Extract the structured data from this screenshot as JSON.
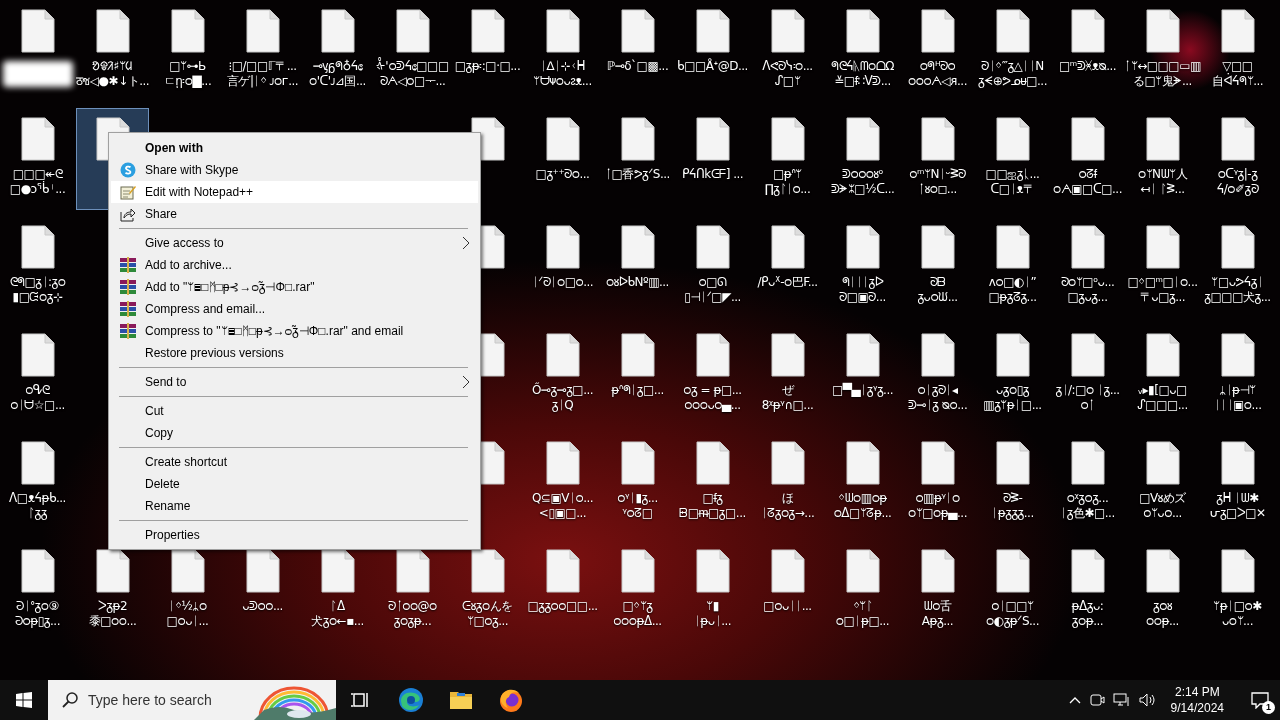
{
  "desktop": {
    "rows": [
      {
        "icons": [
          {
            "kind": "redacted",
            "selected": false
          },
          {
            "kind": "file",
            "selected": false,
            "label": [
              "ᱚᱫᱤ♯ᛘᱢ",
              "ठช◁●✱↓ト..."
            ]
          },
          {
            "kind": "file",
            "selected": false,
            "label": [
              "□ᛘ⊶Ь",
              "ㄷῃ፡ᴑ▇..."
            ]
          },
          {
            "kind": "file",
            "selected": false,
            "label": [
              "⁝□/□□ℾ〒...",
              "言ゲ|ᛁᛜ ᴊᴑᴦ..."
            ]
          },
          {
            "kind": "file",
            "selected": false,
            "label": [
              "⊸ᶌᵷᖗ♁ᔦ᥋",
              "ᴑ'ᑕ'ᴊ⊿国..."
            ]
          },
          {
            "kind": "file",
            "selected": false,
            "label": [
              "ᢤ'ᴑᕲᔦ᥋□□□",
              "ᘐᗅ◁ᴑ□ᅮ..."
            ]
          },
          {
            "kind": "file",
            "selected": false,
            "label": [
              "□ᵹᵽ፡:□·□..."
            ]
          },
          {
            "kind": "file",
            "selected": false,
            "label": [
              "ᛁ∆ᛁ⊹ᚲᕼ",
              "ᛘᗨᴪᴑᴗᴤᴥ..."
            ]
          },
          {
            "kind": "file",
            "selected": false,
            "label": [
              "ℙ⊸δ`□▩..."
            ]
          },
          {
            "kind": "file",
            "selected": false,
            "label": [
              "ᑲ□□Åᕀ@D..."
            ]
          },
          {
            "kind": "file",
            "selected": false,
            "label": [
              "ᐱᕙᘐᓭ፡ᴑ...",
              "ᔑ□ᛘ"
            ]
          },
          {
            "kind": "file",
            "selected": false,
            "label": [
              "ᖗᘓᔦᚣᗰᴑᗝΩ",
              "≚□ᵮ∷ᐯᕲ..."
            ]
          },
          {
            "kind": "file",
            "selected": false,
            "label": [
              "ᴑᖗᵸᘐᴑ",
              "ᴑᴑᴑᗅ◁ᴙ..."
            ]
          },
          {
            "kind": "file",
            "selected": false,
            "label": [
              "ᘐᛁᛜ‴ᵹ△ᛁᛁN",
              "ᵹᗕ⊕ᕗᓄᵾ□..."
            ]
          },
          {
            "kind": "file",
            "selected": false,
            "label": [
              "□ᵐᕲᚸᴥᴓ..."
            ]
          },
          {
            "kind": "file",
            "selected": false,
            "label": [
              "ᛙᛘ↔□□□▭▥",
              "る□ᛘ鬼ᗘ..."
            ]
          },
          {
            "kind": "file",
            "selected": false,
            "label": [
              "▽□□",
              "自ᐋᔦᖗᛘ..."
            ]
          }
        ]
      },
      {
        "left": [
          {
            "kind": "file",
            "selected": false,
            "label": [
              "□□□↞ᘓ",
              "□●ↄᖄᛌ..."
            ]
          },
          {
            "kind": "file",
            "selected": true
          }
        ],
        "right": [
          {
            "kind": "file",
            "selected": false
          },
          {
            "kind": "file",
            "selected": false,
            "label": [
              "□ᵹ⁺⁺ᘐᴑ..."
            ]
          },
          {
            "kind": "file",
            "selected": false,
            "label": [
              "ᛙ□香ᕗᵹᐟS..."
            ]
          },
          {
            "kind": "file",
            "selected": false,
            "label": [
              "ᑭᔦᑎkᕮᖴ] ..."
            ]
          },
          {
            "kind": "file",
            "selected": false,
            "label": [
              "□ᵽᐢᛘ",
              "∏ᵹᛚᛁᴑ..."
            ]
          },
          {
            "kind": "file",
            "selected": false,
            "label": [
              "ᕲᴑᴑᴑᴕᵒ",
              "ᕲᗘᛯ□½ᑕ..."
            ]
          },
          {
            "kind": "file",
            "selected": false,
            "label": [
              "ᴑᵐᛘNᛁᵕᕒᘐ",
              "ᛙᴕᴑ◻..."
            ]
          },
          {
            "kind": "file",
            "selected": false,
            "label": [
              "□□ஐᵹᚳ...",
              "ᑕ□ᛁᴥ〒"
            ]
          },
          {
            "kind": "file",
            "selected": false,
            "label": [
              "ᴑᘔᵮ",
              "ᴑᗅ▣□ᑕ□..."
            ]
          },
          {
            "kind": "file",
            "selected": false,
            "label": [
              "ᴑᛘNᗯᛘ人",
              "↤ᛁ ᛚᕒ..."
            ]
          },
          {
            "kind": "file",
            "selected": false,
            "label": [
              "ᴑᑕᵞᵹ|-ᵹ",
              "ᔦ/ᴑ✐ᵹᘐ"
            ]
          }
        ]
      },
      {
        "left": [
          {
            "kind": "file",
            "selected": false,
            "label": [
              "ᘓᖗ□ᵹᛁ:ᵹᴑ",
              "▮□ᙍᴑᵹ⊹"
            ]
          }
        ],
        "right": [
          {
            "kind": "file",
            "selected": false
          },
          {
            "kind": "file",
            "selected": false,
            "label": [
              "ᛁᐟᘐᛁᴑ□ᴑ..."
            ]
          },
          {
            "kind": "file",
            "selected": false,
            "label": [
              "ᴑᴕᐅᑲNº▥..."
            ]
          },
          {
            "kind": "file",
            "selected": false,
            "label": [
              "ᴑ□ᘏ",
              "▯⊣ᛁᐟ□◤..."
            ]
          },
          {
            "kind": "file",
            "selected": false,
            "label": [
              "/ᑭᴗᕁ-ᴑ巴F..."
            ]
          },
          {
            "kind": "file",
            "selected": false,
            "label": [
              "ᖗᛁᛁᛁᵹᐅ",
              "ᘐ□▣ᘐ..."
            ]
          },
          {
            "kind": "file",
            "selected": false,
            "label": [
              "ᘐᗹ",
              "ᵹᴗᴑᙎ..."
            ]
          },
          {
            "kind": "file",
            "selected": false,
            "label": [
              "ᴧᴑ□◐ᛁ”",
              "□ᵽᵹᘔᵹ..."
            ]
          },
          {
            "kind": "file",
            "selected": false,
            "label": [
              "ᘐᴑᛘ□ᵒᴗ...",
              "□ᵹᴗᵹ..."
            ]
          },
          {
            "kind": "file",
            "selected": false,
            "label": [
              "□ᛜ□ᵐ□ᛁᴑ...",
              "〒ᴗ□ᵹ..."
            ]
          },
          {
            "kind": "file",
            "selected": false,
            "label": [
              "ᛘ□ᴗᕗᔦᵹᛁ",
              "ᵹ□□□犬ᵹ..."
            ]
          }
        ]
      },
      {
        "left": [
          {
            "kind": "file",
            "selected": false,
            "label": [
              "ᴑᕴᘓ",
              "ᴑᛁᗨ☆□..."
            ]
          }
        ],
        "right": [
          {
            "kind": "file",
            "selected": false
          },
          {
            "kind": "file",
            "selected": false,
            "label": [
              "Ő⊸ᵹ⊸ᵹ□...",
              "ᵹᛁQ"
            ]
          },
          {
            "kind": "file",
            "selected": false,
            "label": [
              "ᵽᐢᖗᛁᵹ□..."
            ]
          },
          {
            "kind": "file",
            "selected": false,
            "label": [
              "ᴑᵹ = ᵽ□...",
              "ᴑᴑᴑᴗᴑ▄..."
            ]
          },
          {
            "kind": "file",
            "selected": false,
            "label": [
              "ぜ",
              "8ᵡᵽᵞ∩□..."
            ]
          },
          {
            "kind": "file",
            "selected": false,
            "label": [
              "□▀▄ᛁᵹᵞᵹ..."
            ]
          },
          {
            "kind": "file",
            "selected": false,
            "label": [
              "ᴑᛁᵹᘐᛁ◂",
              "ᕲ⊸ᛁᵹ ᴓᴑ..."
            ]
          },
          {
            "kind": "file",
            "selected": false,
            "label": [
              "ᴗᵹᴑ▯ᵹ",
              "▥ᵹᛘᵽᛁ□..."
            ]
          },
          {
            "kind": "file",
            "selected": false,
            "label": [
              "ᵹᛁ/:□ᴑ ᛁᵹ...",
              "ᴑᛙ"
            ]
          },
          {
            "kind": "file",
            "selected": false,
            "label": [
              "ᵥ▸▮[□ᴗ□",
              "ᔑ□□□..."
            ]
          },
          {
            "kind": "file",
            "selected": false,
            "label": [
              "ᛦᛁᵽ⊣ᛘ",
              "ᛁᛁᛁ▣ᴑ..."
            ]
          }
        ]
      },
      {
        "left": [
          {
            "kind": "file",
            "selected": false,
            "label": [
              "ᐱ□ᴥᔦᵽᑲ...",
              "ᛚᵹᵹ"
            ]
          }
        ],
        "right": [
          {
            "kind": "file",
            "selected": false
          },
          {
            "kind": "file",
            "selected": false,
            "label": [
              "Q⊆▣Vᛁᴑ...",
              "<▯▣□..."
            ]
          },
          {
            "kind": "file",
            "selected": false,
            "label": [
              "ᴑᵞᛁ▮ᵹ...",
              "ᵞᴑᘔ□"
            ]
          },
          {
            "kind": "file",
            "selected": false,
            "label": [
              "□ᵮᵹ",
              "ᗸ□ᵯ□ᵹ□..."
            ]
          },
          {
            "kind": "file",
            "selected": false,
            "label": [
              "ほ",
              "ᛁᘔᵹᴑᵹ→..."
            ]
          },
          {
            "kind": "file",
            "selected": false,
            "label": [
              "ᛜᗯᴑ▥ᴑᵽ",
              "ᴑᐃ□ᛘᘔᵽ..."
            ]
          },
          {
            "kind": "file",
            "selected": false,
            "label": [
              "ᴑ▥ᵽᵞᛁᴑ",
              "ᴑᛘ□ᴑᵽ▄..."
            ]
          },
          {
            "kind": "file",
            "selected": false,
            "label": [
              "ᘐᕒ-",
              "ᛁᵽᵹᵹᵹ..."
            ]
          },
          {
            "kind": "file",
            "selected": false,
            "label": [
              "ᴑᵡᵹᴑᵹ...",
              "ᛁᵹ色✱□..."
            ]
          },
          {
            "kind": "file",
            "selected": false,
            "label": [
              "□Vᴕめズ",
              "ᴑᛘᴗᴑ..."
            ]
          },
          {
            "kind": "file",
            "selected": false,
            "label": [
              "ᵹᕼ ᛁᗯ✱",
              "ᕂᵹ□ᐳ□✕"
            ]
          }
        ]
      },
      {
        "icons": [
          {
            "kind": "file",
            "selected": false,
            "label": [
              "ᘒᛁᐤᵹᴑ⑨",
              "ᘒᴑᵽ▯ᵹ..."
            ]
          },
          {
            "kind": "file",
            "selected": false,
            "label": [
              "ᐳᵹᵽ2",
              "黍□ᴑᴑ..."
            ]
          },
          {
            "kind": "file",
            "selected": false,
            "label": [
              "ᛁᛜ½ᛦᴑ",
              "□ᴑᴗᛁ..."
            ]
          },
          {
            "kind": "file",
            "selected": false,
            "label": [
              "ᴗᕲᴑᴑ..."
            ]
          },
          {
            "kind": "file",
            "selected": false,
            "label": [
              "ᛚᐃ",
              "犬ᵹᴑ←▪..."
            ]
          },
          {
            "kind": "file",
            "selected": false,
            "label": [
              "ᘐᛙᴑᴑ@ᴑ",
              "ᵹᴑᵹᵽ..."
            ]
          },
          {
            "kind": "file",
            "selected": false,
            "label": [
              "ᕮᴕᵹᴑんを",
              "ᛘ□ᴑᵹ..."
            ]
          },
          {
            "kind": "file",
            "selected": false,
            "label": [
              "□ᵹᵹᴑᴑ□□..."
            ]
          },
          {
            "kind": "file",
            "selected": false,
            "label": [
              "□ᛜᛘᵹ",
              "ᴑᴑᴑᵽᐃ..."
            ]
          },
          {
            "kind": "file",
            "selected": false,
            "label": [
              "ᛘ▮",
              "ᛁᵽᴗᛁ..."
            ]
          },
          {
            "kind": "file",
            "selected": false,
            "label": [
              "□ᴑᴗᛁᛁ..."
            ]
          },
          {
            "kind": "file",
            "selected": false,
            "label": [
              "ᛜᛘᛚ",
              "ᴑ□ᛁᵽ□..."
            ]
          },
          {
            "kind": "file",
            "selected": false,
            "label": [
              "ᗯᴑ舌",
              "Aᵽᵹ..."
            ]
          },
          {
            "kind": "file",
            "selected": false,
            "label": [
              "ᴑᛁ□□ᛘ",
              "ᴑ◐ᵹᵽᐟS..."
            ]
          },
          {
            "kind": "file",
            "selected": false,
            "label": [
              "ᵽᐃᵹᴗ:",
              "ᵹᴑᵽ..."
            ]
          },
          {
            "kind": "file",
            "selected": false,
            "label": [
              "ᵹᴑᴕ",
              "ᴑᴑᵽ..."
            ]
          },
          {
            "kind": "file",
            "selected": false,
            "label": [
              "ᛘᵽᛁ□ᴑ✱",
              "ᴗᴑᛘ..."
            ]
          }
        ]
      }
    ]
  },
  "context_menu": {
    "items": [
      {
        "kind": "plain",
        "label": "Open with",
        "bold": true,
        "selected": false,
        "submenu": false
      },
      {
        "kind": "skype",
        "label": "Share with Skype",
        "bold": false,
        "selected": false,
        "submenu": false
      },
      {
        "kind": "notepad",
        "label": "Edit with Notepad++",
        "bold": false,
        "selected": true,
        "submenu": false
      },
      {
        "kind": "share",
        "label": "Share",
        "bold": false,
        "selected": false,
        "submenu": false
      },
      {
        "kind": "separator"
      },
      {
        "kind": "plain",
        "label": "Give access to",
        "bold": false,
        "selected": false,
        "submenu": true
      },
      {
        "kind": "archive",
        "label": "Add to archive...",
        "bold": false,
        "selected": false,
        "submenu": false
      },
      {
        "kind": "archive",
        "label": "Add to \"ᛘ▤□ᛗ□ᵽ⊰→ᴑ̃ᵹ⊣Φ□.rar\"",
        "bold": false,
        "selected": false,
        "submenu": false
      },
      {
        "kind": "archive",
        "label": "Compress and email...",
        "bold": false,
        "selected": false,
        "submenu": false
      },
      {
        "kind": "archive",
        "label": "Compress to \"ᛘ▤□ᛗ□ᵽ⊰→ᴑ̃ᵹ⊣Φ□.rar\" and email",
        "bold": false,
        "selected": false,
        "submenu": false
      },
      {
        "kind": "plain",
        "label": "Restore previous versions",
        "bold": false,
        "selected": false,
        "submenu": false
      },
      {
        "kind": "separator"
      },
      {
        "kind": "plain",
        "label": "Send to",
        "bold": false,
        "selected": false,
        "submenu": true
      },
      {
        "kind": "separator"
      },
      {
        "kind": "plain",
        "label": "Cut",
        "bold": false,
        "selected": false,
        "submenu": false
      },
      {
        "kind": "plain",
        "label": "Copy",
        "bold": false,
        "selected": false,
        "submenu": false
      },
      {
        "kind": "separator"
      },
      {
        "kind": "plain",
        "label": "Create shortcut",
        "bold": false,
        "selected": false,
        "submenu": false
      },
      {
        "kind": "plain",
        "label": "Delete",
        "bold": false,
        "selected": false,
        "submenu": false
      },
      {
        "kind": "plain",
        "label": "Rename",
        "bold": false,
        "selected": false,
        "submenu": false
      },
      {
        "kind": "separator"
      },
      {
        "kind": "plain",
        "label": "Properties",
        "bold": false,
        "selected": false,
        "submenu": false
      }
    ]
  },
  "taskbar": {
    "search": {
      "placeholder": "Type here to search"
    },
    "clock": {
      "time": "2:14 PM",
      "date": "9/14/2024"
    },
    "notifications": "1"
  }
}
